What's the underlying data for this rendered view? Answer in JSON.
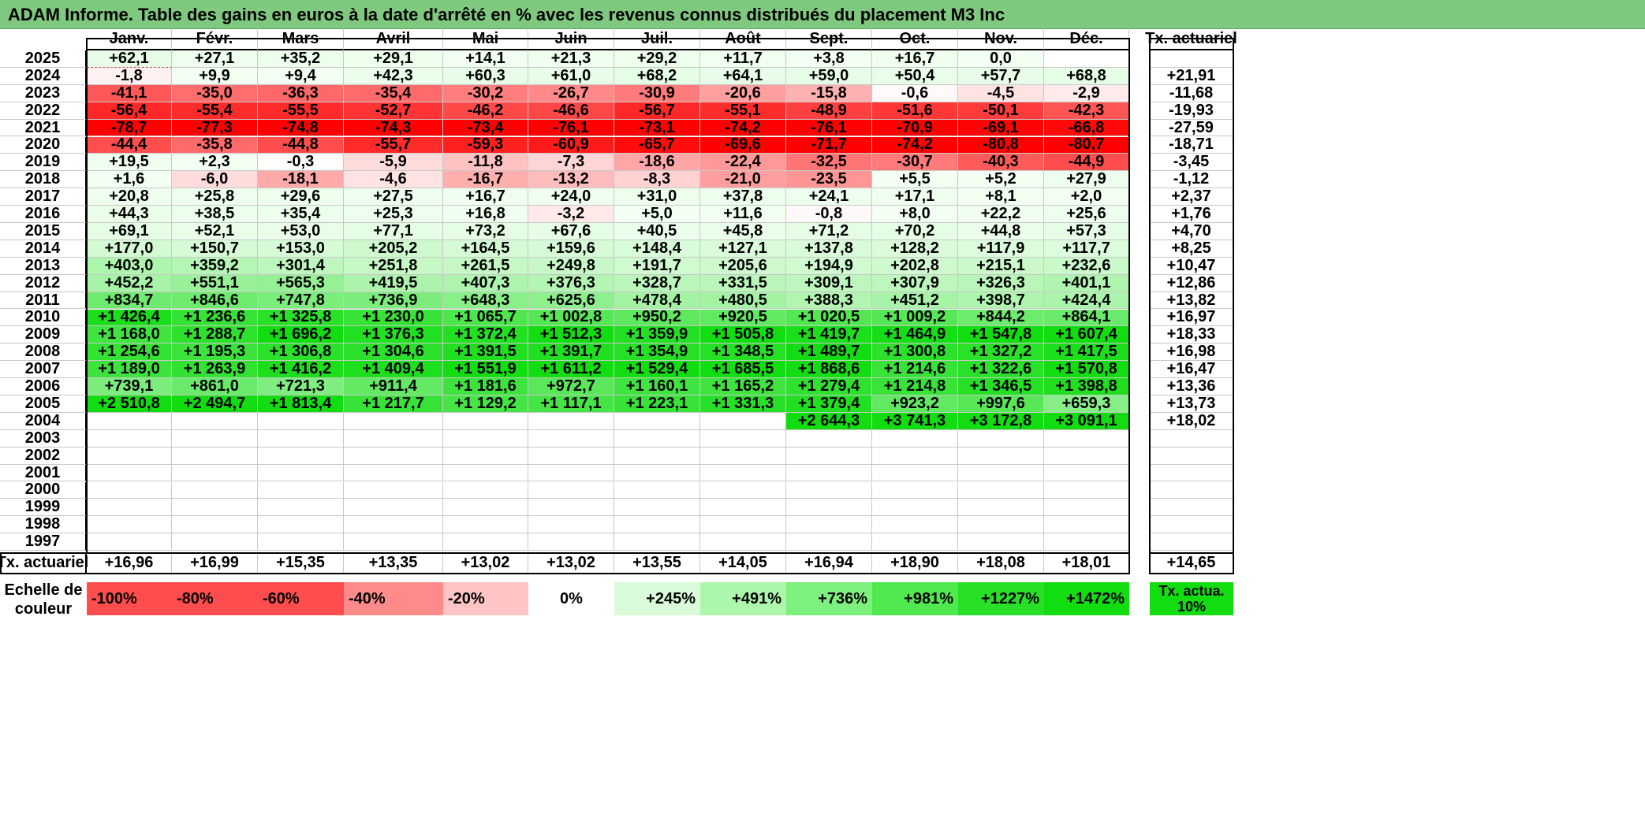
{
  "title": "ADAM Informe. Table des gains en euros à la date d'arrêté en % avec les revenus connus distribués du placement M3 Inc",
  "months": [
    "Janv.",
    "Févr.",
    "Mars",
    "Avril",
    "Mai",
    "Juin",
    "Juil.",
    "Août",
    "Sept.",
    "Oct.",
    "Nov.",
    "Déc."
  ],
  "rate_header": "Tx. actuariel",
  "rows": [
    {
      "year": "2025",
      "values": [
        "+62,1",
        "+27,1",
        "+35,2",
        "+29,1",
        "+14,1",
        "+21,3",
        "+29,2",
        "+11,7",
        "+3,8",
        "+16,7",
        "0,0",
        ""
      ],
      "rate": ""
    },
    {
      "year": "2024",
      "values": [
        "-1,8",
        "+9,9",
        "+9,4",
        "+42,3",
        "+60,3",
        "+61,0",
        "+68,2",
        "+64,1",
        "+59,0",
        "+50,4",
        "+57,7",
        "+68,8"
      ],
      "rate": "+21,91"
    },
    {
      "year": "2023",
      "values": [
        "-41,1",
        "-35,0",
        "-36,3",
        "-35,4",
        "-30,2",
        "-26,7",
        "-30,9",
        "-20,6",
        "-15,8",
        "-0,6",
        "-4,5",
        "-2,9"
      ],
      "rate": "-11,68"
    },
    {
      "year": "2022",
      "values": [
        "-56,4",
        "-55,4",
        "-55,5",
        "-52,7",
        "-46,2",
        "-46,6",
        "-56,7",
        "-55,1",
        "-48,9",
        "-51,6",
        "-50,1",
        "-42,3"
      ],
      "rate": "-19,93"
    },
    {
      "year": "2021",
      "values": [
        "-78,7",
        "-77,3",
        "-74,8",
        "-74,3",
        "-73,4",
        "-76,1",
        "-73,1",
        "-74,2",
        "-76,1",
        "-70,9",
        "-69,1",
        "-66,8"
      ],
      "rate": "-27,59"
    },
    {
      "year": "2020",
      "values": [
        "-44,4",
        "-35,8",
        "-44,8",
        "-55,7",
        "-59,3",
        "-60,9",
        "-65,7",
        "-69,6",
        "-71,7",
        "-74,2",
        "-80,8",
        "-80,7"
      ],
      "rate": "-18,71"
    },
    {
      "year": "2019",
      "values": [
        "+19,5",
        "+2,3",
        "-0,3",
        "-5,9",
        "-11,8",
        "-7,3",
        "-18,6",
        "-22,4",
        "-32,5",
        "-30,7",
        "-40,3",
        "-44,9"
      ],
      "rate": "-3,45"
    },
    {
      "year": "2018",
      "values": [
        "+1,6",
        "-6,0",
        "-18,1",
        "-4,6",
        "-16,7",
        "-13,2",
        "-8,3",
        "-21,0",
        "-23,5",
        "+5,5",
        "+5,2",
        "+27,9"
      ],
      "rate": "-1,12"
    },
    {
      "year": "2017",
      "values": [
        "+20,8",
        "+25,8",
        "+29,6",
        "+27,5",
        "+16,7",
        "+24,0",
        "+31,0",
        "+37,8",
        "+24,1",
        "+17,1",
        "+8,1",
        "+2,0"
      ],
      "rate": "+2,37"
    },
    {
      "year": "2016",
      "values": [
        "+44,3",
        "+38,5",
        "+35,4",
        "+25,3",
        "+16,8",
        "-3,2",
        "+5,0",
        "+11,6",
        "-0,8",
        "+8,0",
        "+22,2",
        "+25,6"
      ],
      "rate": "+1,76"
    },
    {
      "year": "2015",
      "values": [
        "+69,1",
        "+52,1",
        "+53,0",
        "+77,1",
        "+73,2",
        "+67,6",
        "+40,5",
        "+45,8",
        "+71,2",
        "+70,2",
        "+44,8",
        "+57,3"
      ],
      "rate": "+4,70"
    },
    {
      "year": "2014",
      "values": [
        "+177,0",
        "+150,7",
        "+153,0",
        "+205,2",
        "+164,5",
        "+159,6",
        "+148,4",
        "+127,1",
        "+137,8",
        "+128,2",
        "+117,9",
        "+117,7"
      ],
      "rate": "+8,25"
    },
    {
      "year": "2013",
      "values": [
        "+403,0",
        "+359,2",
        "+301,4",
        "+251,8",
        "+261,5",
        "+249,8",
        "+191,7",
        "+205,6",
        "+194,9",
        "+202,8",
        "+215,1",
        "+232,6"
      ],
      "rate": "+10,47"
    },
    {
      "year": "2012",
      "values": [
        "+452,2",
        "+551,1",
        "+565,3",
        "+419,5",
        "+407,3",
        "+376,3",
        "+328,7",
        "+331,5",
        "+309,1",
        "+307,9",
        "+326,3",
        "+401,1"
      ],
      "rate": "+12,86"
    },
    {
      "year": "2011",
      "values": [
        "+834,7",
        "+846,6",
        "+747,8",
        "+736,9",
        "+648,3",
        "+625,6",
        "+478,4",
        "+480,5",
        "+388,3",
        "+451,2",
        "+398,7",
        "+424,4"
      ],
      "rate": "+13,82"
    },
    {
      "year": "2010",
      "values": [
        "+1 426,4",
        "+1 236,6",
        "+1 325,8",
        "+1 230,0",
        "+1 065,7",
        "+1 002,8",
        "+950,2",
        "+920,5",
        "+1 020,5",
        "+1 009,2",
        "+844,2",
        "+864,1"
      ],
      "rate": "+16,97"
    },
    {
      "year": "2009",
      "values": [
        "+1 168,0",
        "+1 288,7",
        "+1 696,2",
        "+1 376,3",
        "+1 372,4",
        "+1 512,3",
        "+1 359,9",
        "+1 505,8",
        "+1 419,7",
        "+1 464,9",
        "+1 547,8",
        "+1 607,4"
      ],
      "rate": "+18,33"
    },
    {
      "year": "2008",
      "values": [
        "+1 254,6",
        "+1 195,3",
        "+1 306,8",
        "+1 304,6",
        "+1 391,5",
        "+1 391,7",
        "+1 354,9",
        "+1 348,5",
        "+1 489,7",
        "+1 300,8",
        "+1 327,2",
        "+1 417,5"
      ],
      "rate": "+16,98"
    },
    {
      "year": "2007",
      "values": [
        "+1 189,0",
        "+1 263,9",
        "+1 416,2",
        "+1 409,4",
        "+1 551,9",
        "+1 611,2",
        "+1 529,4",
        "+1 685,5",
        "+1 868,6",
        "+1 214,6",
        "+1 322,6",
        "+1 570,8"
      ],
      "rate": "+16,47"
    },
    {
      "year": "2006",
      "values": [
        "+739,1",
        "+861,0",
        "+721,3",
        "+911,4",
        "+1 181,6",
        "+972,7",
        "+1 160,1",
        "+1 165,2",
        "+1 279,4",
        "+1 214,8",
        "+1 346,5",
        "+1 398,8"
      ],
      "rate": "+13,36"
    },
    {
      "year": "2005",
      "values": [
        "+2 510,8",
        "+2 494,7",
        "+1 813,4",
        "+1 217,7",
        "+1 129,2",
        "+1 117,1",
        "+1 223,1",
        "+1 331,3",
        "+1 379,4",
        "+923,2",
        "+997,6",
        "+659,3"
      ],
      "rate": "+13,73"
    },
    {
      "year": "2004",
      "values": [
        "",
        "",
        "",
        "",
        "",
        "",
        "",
        "",
        "+2 644,3",
        "+3 741,3",
        "+3 172,8",
        "+3 091,1"
      ],
      "rate": "+18,02"
    },
    {
      "year": "2003",
      "values": [
        "",
        "",
        "",
        "",
        "",
        "",
        "",
        "",
        "",
        "",
        "",
        ""
      ],
      "rate": ""
    },
    {
      "year": "2002",
      "values": [
        "",
        "",
        "",
        "",
        "",
        "",
        "",
        "",
        "",
        "",
        "",
        ""
      ],
      "rate": ""
    },
    {
      "year": "2001",
      "values": [
        "",
        "",
        "",
        "",
        "",
        "",
        "",
        "",
        "",
        "",
        "",
        ""
      ],
      "rate": ""
    },
    {
      "year": "2000",
      "values": [
        "",
        "",
        "",
        "",
        "",
        "",
        "",
        "",
        "",
        "",
        "",
        ""
      ],
      "rate": ""
    },
    {
      "year": "1999",
      "values": [
        "",
        "",
        "",
        "",
        "",
        "",
        "",
        "",
        "",
        "",
        "",
        ""
      ],
      "rate": ""
    },
    {
      "year": "1998",
      "values": [
        "",
        "",
        "",
        "",
        "",
        "",
        "",
        "",
        "",
        "",
        "",
        ""
      ],
      "rate": ""
    },
    {
      "year": "1997",
      "values": [
        "",
        "",
        "",
        "",
        "",
        "",
        "",
        "",
        "",
        "",
        "",
        ""
      ],
      "rate": ""
    }
  ],
  "footer": {
    "label": "Tx. actuariel",
    "values": [
      "+16,96",
      "+16,99",
      "+15,35",
      "+13,35",
      "+13,02",
      "+13,02",
      "+13,55",
      "+14,05",
      "+16,94",
      "+18,90",
      "+18,08",
      "+18,01"
    ],
    "total": "+14,65"
  },
  "legend": {
    "label": "Echelle de couleur",
    "items": [
      {
        "text": "-100%",
        "color": "#ff4d4d"
      },
      {
        "text": "-80%",
        "color": "#ff4d4d"
      },
      {
        "text": "-60%",
        "color": "#ff4d4d"
      },
      {
        "text": "-40%",
        "color": "#ff8a8a"
      },
      {
        "text": "-20%",
        "color": "#ffc4c4"
      },
      {
        "text": "0%",
        "color": "#ffffff"
      },
      {
        "text": "+245%",
        "color": "#d9fbd9"
      },
      {
        "text": "+491%",
        "color": "#adf7ad"
      },
      {
        "text": "+736%",
        "color": "#7df07d"
      },
      {
        "text": "+981%",
        "color": "#4fe94f"
      },
      {
        "text": "+1227%",
        "color": "#28e028"
      },
      {
        "text": "+1472%",
        "color": "#11dd11"
      }
    ],
    "rate_text": "Tx. actua. 10%",
    "rate_color": "#11dd11"
  },
  "colors": {
    "title_bg": "#7ec97e",
    "negative_max": "#ff0000",
    "neutral": "#ffffff",
    "positive_max": "#11dd11"
  }
}
